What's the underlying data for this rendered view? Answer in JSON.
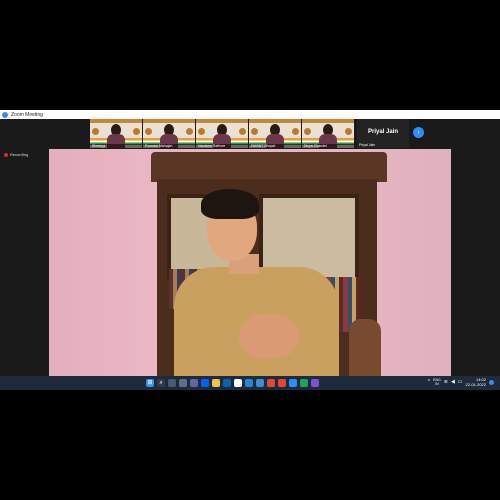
{
  "window": {
    "title": "Zoom Meeting"
  },
  "participants": [
    {
      "name": "Shreeya"
    },
    {
      "name": "Poonam Mahajan"
    },
    {
      "name": "Vandana Rathore"
    },
    {
      "name": "DMSNT Bhopal"
    },
    {
      "name": "Divya Chandel"
    }
  ],
  "active_speaker": {
    "name": "Priyal Jain",
    "label": "Priyal Jain"
  },
  "recording": {
    "label": "Recording"
  },
  "taskbar": {
    "icons": [
      "windows-start",
      "search",
      "file-explorer",
      "widgets",
      "chat",
      "dropbox",
      "folder",
      "mail",
      "edge",
      "chrome",
      "store",
      "word",
      "excel",
      "zoom",
      "teams",
      "media"
    ],
    "tray": {
      "lang_top": "ENG",
      "lang_bottom": "IN",
      "time": "14:02",
      "date": "22-01-2022"
    }
  },
  "colors": {
    "zoom_blue": "#2d8cff",
    "record_red": "#e0282e",
    "taskbar": "#1f2a3a"
  }
}
